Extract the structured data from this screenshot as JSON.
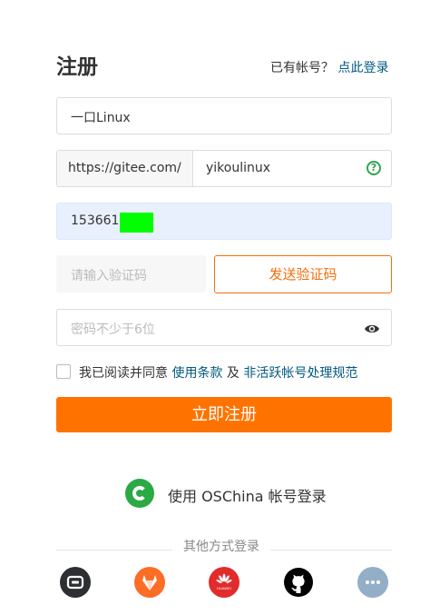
{
  "header": {
    "title": "注册",
    "have_account": "已有帐号？",
    "login_link": "点此登录"
  },
  "form": {
    "name_value": "一口Linux",
    "url_prefix": "https://gitee.com/",
    "url_path": "yikoulinux",
    "url_help_icon": "question-circle-icon",
    "phone_value": "1536616",
    "code_placeholder": "请输入验证码",
    "send_code_label": "发送验证码",
    "password_placeholder": "密码不少于6位",
    "password_icon": "eye-icon",
    "agree_checked": false,
    "agree_prefix": "我已阅读并同意",
    "terms_link": "使用条款",
    "agree_and": "及",
    "inactive_policy_link": "非活跃帐号处理规范",
    "submit_label": "立即注册"
  },
  "oschina": {
    "label": "使用 OSChina 帐号登录",
    "icon": "oschina-logo-icon"
  },
  "other_login": {
    "divider_label": "其他方式登录",
    "providers": [
      {
        "name": "gitee",
        "icon": "gitee-icon",
        "color": "#2d2f33"
      },
      {
        "name": "gitlab",
        "icon": "gitlab-icon",
        "color": "#fc6d26"
      },
      {
        "name": "huawei",
        "icon": "huawei-icon",
        "color": "#e22b2b",
        "text": "HUAWEI"
      },
      {
        "name": "github",
        "icon": "github-icon",
        "color": "#000000"
      },
      {
        "name": "more",
        "icon": "more-icon",
        "color": "#93aec6"
      }
    ]
  },
  "colors": {
    "accent": "#fe7300",
    "link": "#005980",
    "oschina_green": "#2aa944",
    "phone_field_bg": "#e8f0fe"
  }
}
